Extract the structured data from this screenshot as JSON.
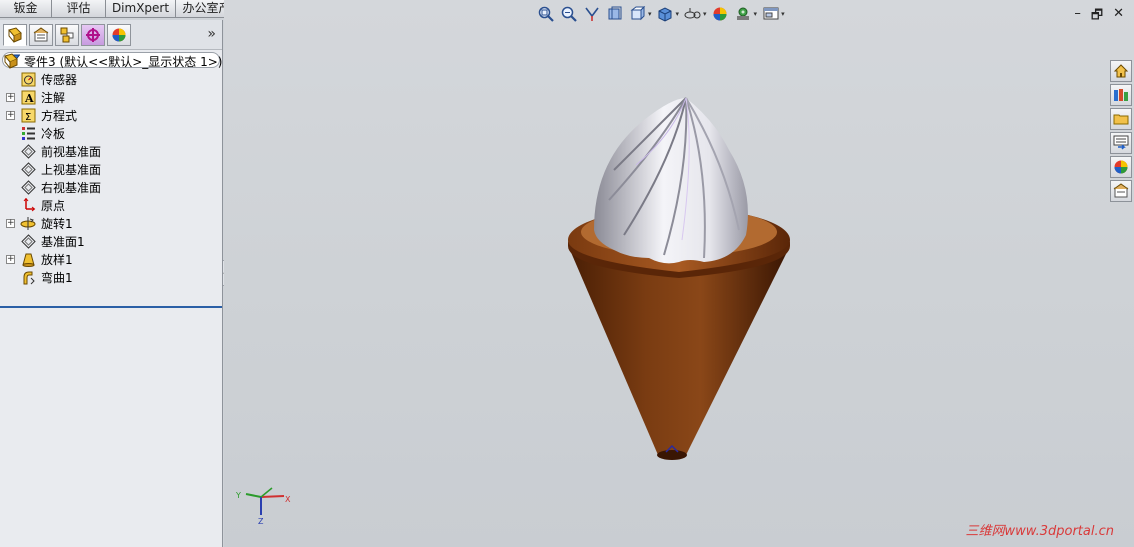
{
  "tabs": [
    "钣金",
    "评估",
    "DimXpert",
    "办公室产品"
  ],
  "panel": {
    "tab_icons": [
      "feature-manager-icon",
      "property-manager-icon",
      "configuration-manager-icon",
      "dimxpert-manager-icon",
      "display-manager-icon"
    ],
    "expand_glyph": "»",
    "root_label": "零件3  (默认<<默认>_显示状态 1>)",
    "tree": [
      {
        "label": "传感器",
        "icon": "sensor-icon",
        "expandable": false
      },
      {
        "label": "注解",
        "icon": "annotation-icon",
        "expandable": true
      },
      {
        "label": "方程式",
        "icon": "equation-icon",
        "expandable": true
      },
      {
        "label": "冷板",
        "icon": "material-icon",
        "expandable": false
      },
      {
        "label": "前视基准面",
        "icon": "plane-icon",
        "expandable": false
      },
      {
        "label": "上视基准面",
        "icon": "plane-icon",
        "expandable": false
      },
      {
        "label": "右视基准面",
        "icon": "plane-icon",
        "expandable": false
      },
      {
        "label": "原点",
        "icon": "origin-icon",
        "expandable": false
      },
      {
        "label": "旋转1",
        "icon": "revolve-icon",
        "expandable": true
      },
      {
        "label": "基准面1",
        "icon": "plane-icon",
        "expandable": false
      },
      {
        "label": "放样1",
        "icon": "loft-icon",
        "expandable": true
      },
      {
        "label": "弯曲1",
        "icon": "flex-icon",
        "expandable": false
      }
    ]
  },
  "window_controls": {
    "minimize": "–",
    "restore": "🗗",
    "close": "✕"
  },
  "triad": {
    "x": "X",
    "y": "Y",
    "z": "Z"
  },
  "watermark": "三维网www.3dportal.cn",
  "colors": {
    "cone": "#6b3310",
    "cream": "#e9e9ee",
    "selection": "#2b5fa6",
    "watermark": "#d93a3a"
  }
}
